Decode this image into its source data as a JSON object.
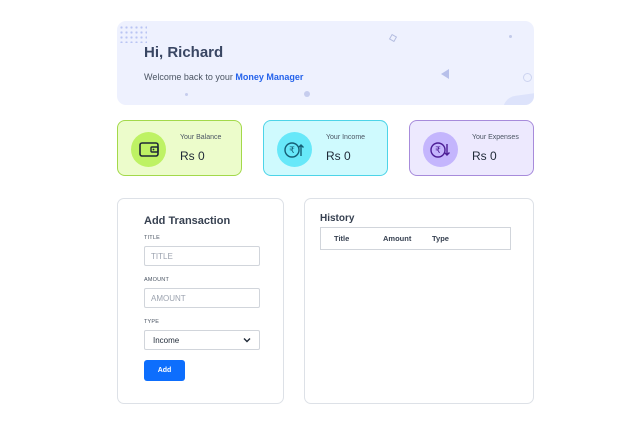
{
  "banner": {
    "greeting": "Hi, Richard",
    "welcome_prefix": "Welcome back to your",
    "brand": "Money Manager"
  },
  "cards": {
    "balance": {
      "label": "Your Balance",
      "value": "Rs 0",
      "icon": "wallet-icon",
      "color": "#ecfccb"
    },
    "income": {
      "label": "Your Income",
      "value": "Rs 0",
      "icon": "rupee-up-icon",
      "color": "#cffafe"
    },
    "expenses": {
      "label": "Your Expenses",
      "value": "Rs 0",
      "icon": "rupee-down-icon",
      "color": "#ede9fe"
    }
  },
  "add_transaction": {
    "title": "Add Transaction",
    "title_label": "TITLE",
    "title_placeholder": "TITLE",
    "amount_label": "AMOUNT",
    "amount_placeholder": "AMOUNT",
    "type_label": "TYPE",
    "type_selected": "Income",
    "add_label": "Add",
    "button_color": "#0d6efd"
  },
  "history": {
    "title": "History",
    "columns": [
      "Title",
      "Amount",
      "Type"
    ]
  }
}
